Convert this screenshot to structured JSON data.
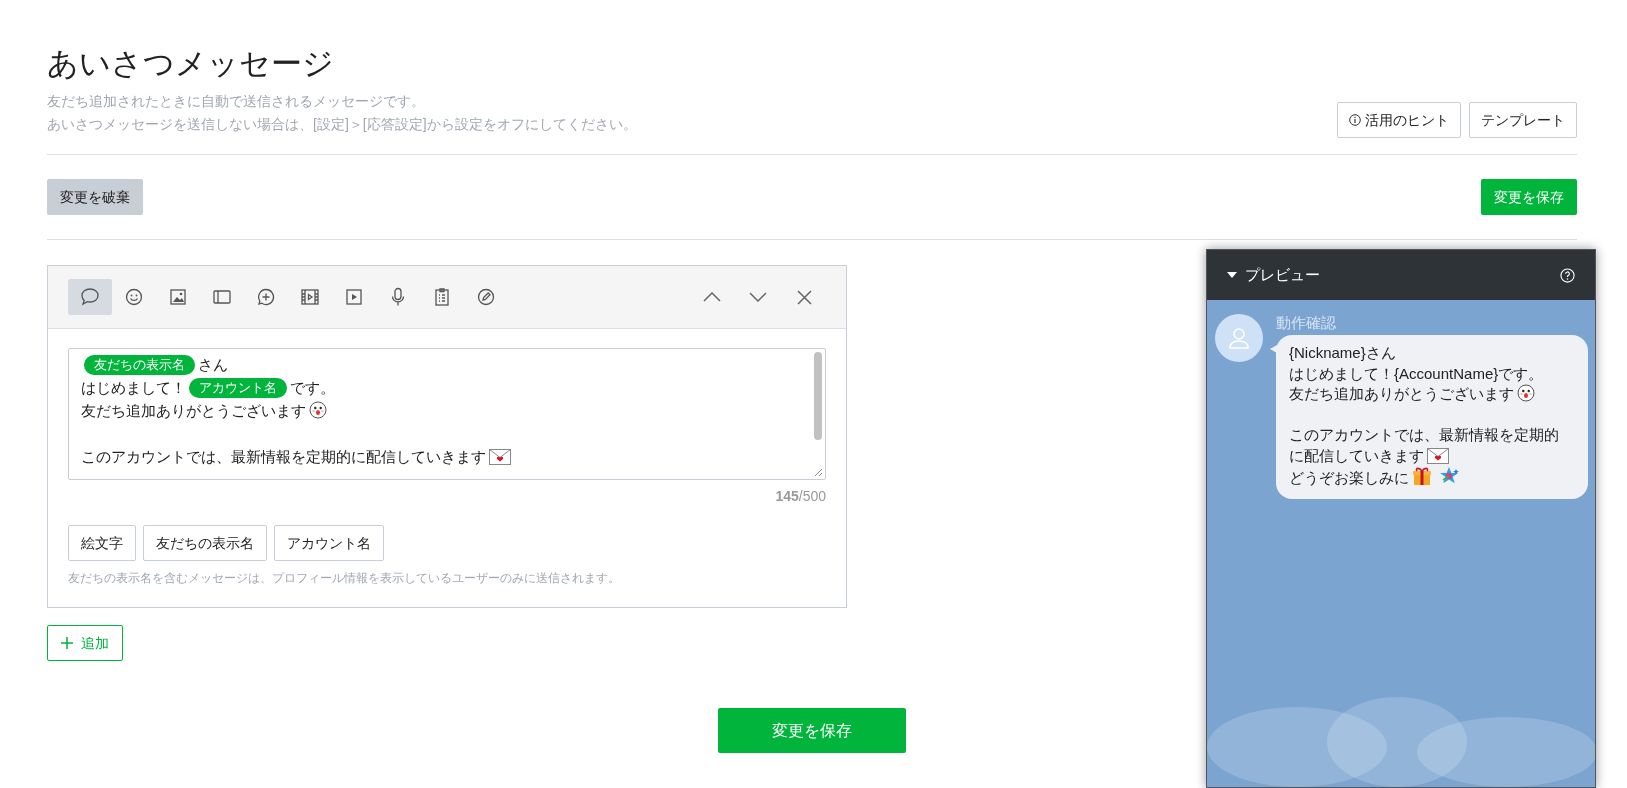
{
  "page": {
    "title": "あいさつメッセージ",
    "description": [
      "友だち追加されたときに自動で送信されるメッセージです。",
      "あいさつメッセージを送信しない場合は、[設定]＞[応答設定]から設定をオフにしてください。"
    ]
  },
  "header_buttons": [
    {
      "kind": "hint",
      "label": "活用のヒント"
    },
    {
      "kind": "plain",
      "label": "テンプレート"
    }
  ],
  "discard_button": "変更を破棄",
  "save_button_top": "変更を保存",
  "editor": {
    "tools": [
      {
        "selected": true
      },
      {
        "selected": false
      },
      {
        "selected": false
      },
      {
        "selected": false
      },
      {
        "selected": false
      },
      {
        "selected": false
      },
      {
        "selected": false
      },
      {
        "selected": false
      },
      {
        "selected": false
      },
      {
        "selected": false
      }
    ],
    "paragraphs": [
      [
        [
          {
            "kind": "tag",
            "text": "友だちの表示名"
          },
          {
            "kind": "text",
            "text": "さん"
          }
        ],
        [
          {
            "kind": "text",
            "text": "はじめまして！"
          },
          {
            "kind": "tag",
            "text": "アカウント名"
          },
          {
            "kind": "text",
            "text": "です。"
          }
        ],
        [
          {
            "kind": "text",
            "text": "友だち追加ありがとうございます"
          },
          {
            "kind": "emoji"
          }
        ]
      ],
      [
        [
          {
            "kind": "text",
            "text": "このアカウントでは、最新情報を定期的に配信していきます"
          },
          {
            "kind": "emoji"
          }
        ]
      ]
    ],
    "counter": "**145**/500",
    "insert_buttons": [
      "絵文字",
      "友だちの表示名",
      "アカウント名"
    ],
    "note": "友だちの表示名を含むメッセージは、プロフィール情報を表示しているユーザーのみに送信されます。"
  },
  "add_button": "追加",
  "save_button_bottom": "変更を保存",
  "preview": {
    "title": "プレビュー",
    "sender": "動作確認",
    "paragraphs": [
      [
        [
          {
            "kind": "text",
            "text": "{Nickname}さん"
          }
        ],
        [
          {
            "kind": "text",
            "text": "はじめまして！{AccountName}です。"
          }
        ],
        [
          {
            "kind": "text",
            "text": "友だち追加ありがとうございます"
          },
          {
            "kind": "emoji"
          }
        ]
      ],
      [
        [
          {
            "kind": "text",
            "text": "このアカウントでは、最新情報を定期的"
          }
        ],
        [
          {
            "kind": "text",
            "text": "に配信していきます"
          },
          {
            "kind": "emoji"
          }
        ],
        [
          {
            "kind": "text",
            "text": "どうぞお楽しみに"
          },
          {
            "kind": "emoji"
          },
          {
            "kind": "emoji"
          }
        ]
      ]
    ]
  }
}
